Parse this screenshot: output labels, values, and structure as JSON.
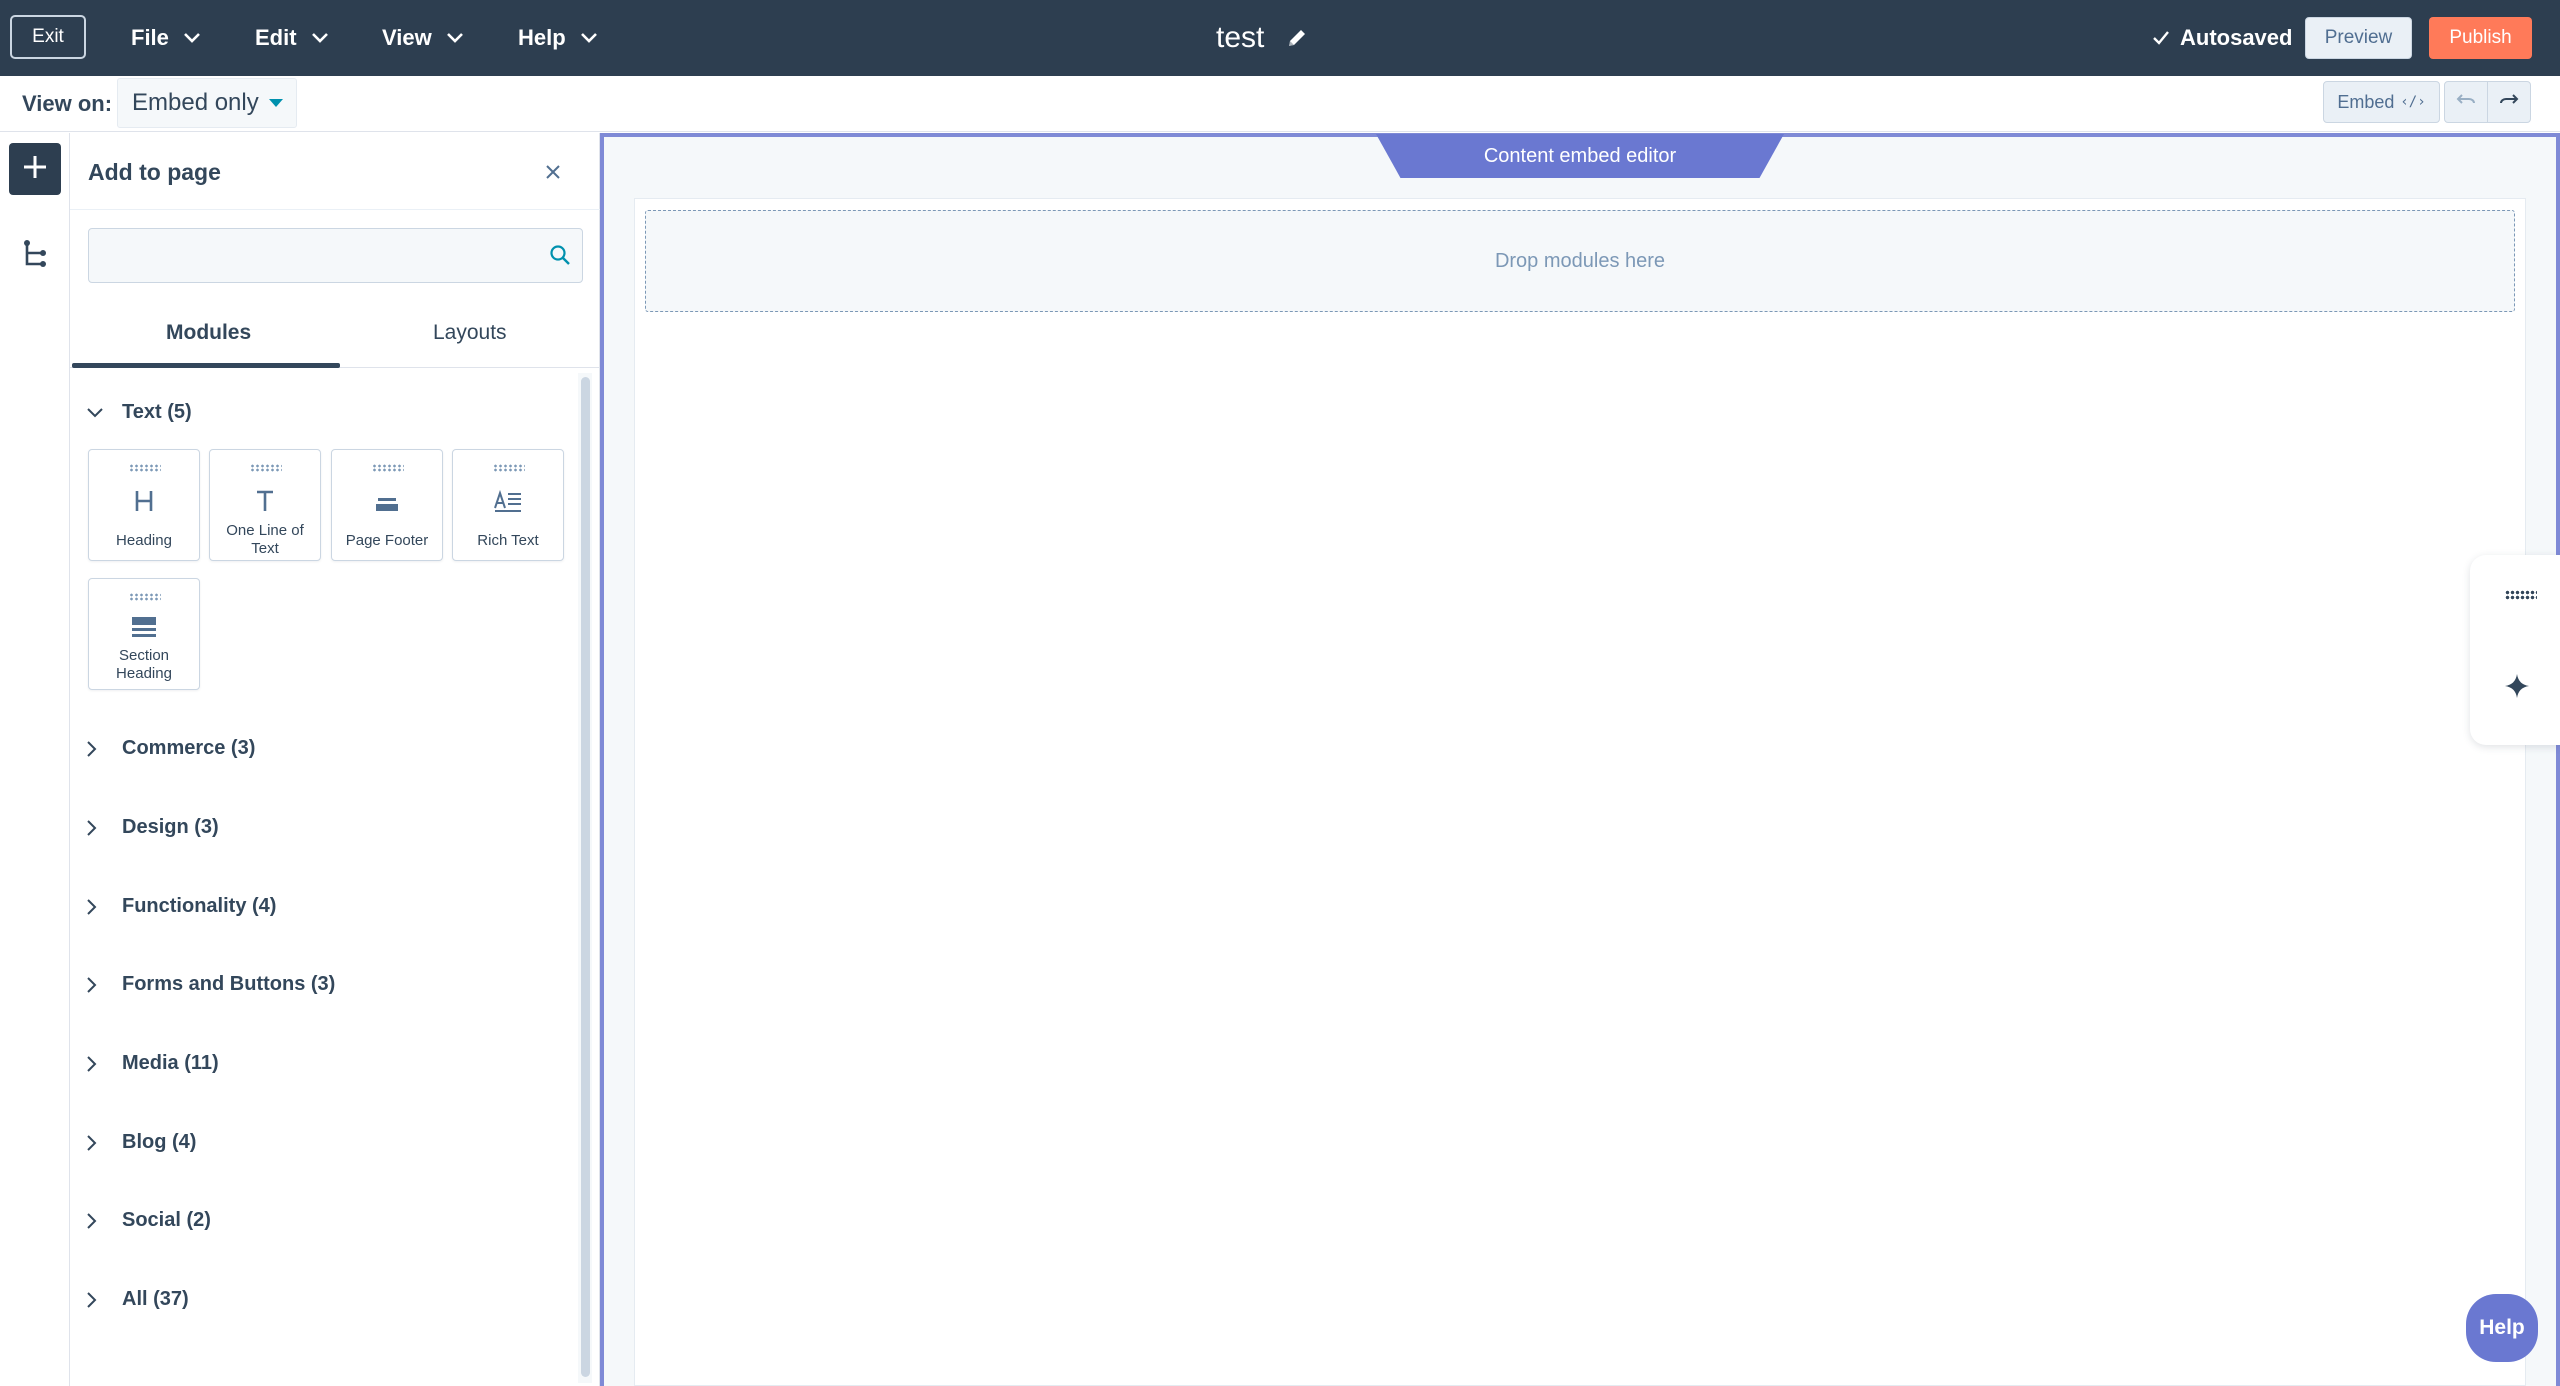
{
  "topbar": {
    "exit_label": "Exit",
    "menus": [
      "File",
      "Edit",
      "View",
      "Help"
    ],
    "page_title": "test",
    "autosaved_label": "Autosaved",
    "preview_label": "Preview",
    "publish_label": "Publish"
  },
  "subbar": {
    "view_on_label": "View on:",
    "view_on_value": "Embed only",
    "embed_label": "Embed"
  },
  "panel": {
    "title": "Add to page",
    "search_placeholder": "",
    "tabs": [
      "Modules",
      "Layouts"
    ],
    "active_tab": "Modules",
    "expanded_category": "Text (5)",
    "text_modules": [
      "Heading",
      "One Line of Text",
      "Page Footer",
      "Rich Text",
      "Section Heading"
    ],
    "categories": [
      "Commerce (3)",
      "Design (3)",
      "Functionality (4)",
      "Forms and Buttons (3)",
      "Media (11)",
      "Blog (4)",
      "Social (2)",
      "All (37)"
    ]
  },
  "canvas": {
    "editor_label": "Content embed editor",
    "dropzone_label": "Drop modules here"
  },
  "help_label": "Help",
  "colors": {
    "topbar": "#2d3e50",
    "publish": "#ff7a59",
    "accent": "#6a78d1"
  }
}
